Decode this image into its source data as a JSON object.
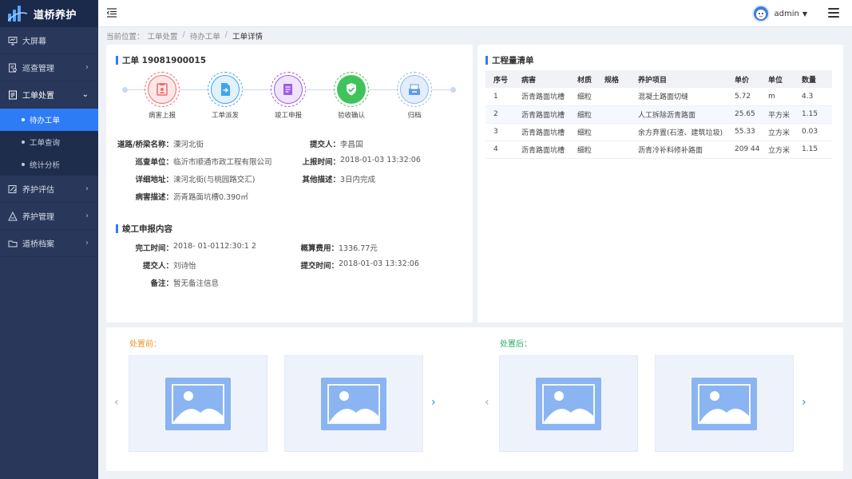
{
  "app": {
    "title": "道桥养护"
  },
  "sidebar": {
    "items": [
      {
        "label": "大屏幕",
        "icon": "monitor-icon"
      },
      {
        "label": "巡查管理",
        "icon": "inspection-icon"
      },
      {
        "label": "工单处置",
        "icon": "workorder-icon",
        "open": true,
        "children": [
          {
            "label": "待办工单",
            "active": true
          },
          {
            "label": "工单查询"
          },
          {
            "label": "统计分析"
          }
        ]
      },
      {
        "label": "养护评估",
        "icon": "evaluate-icon"
      },
      {
        "label": "养护管理",
        "icon": "maintenance-icon"
      },
      {
        "label": "道桥档案",
        "icon": "archive-icon"
      }
    ]
  },
  "header": {
    "user": "admin"
  },
  "breadcrumb": {
    "prefix": "当前位置：",
    "items": [
      "工单处置",
      "待办工单"
    ],
    "separator": "/",
    "current": "工单详情"
  },
  "order": {
    "title": "工单 19081900015",
    "steps": [
      {
        "label": "病害上报",
        "color": "#f06a6a",
        "icon": "report-icon"
      },
      {
        "label": "工单派发",
        "color": "#3fa4f2",
        "icon": "dispatch-icon"
      },
      {
        "label": "竣工申报",
        "color": "#9b5de5",
        "icon": "complete-icon"
      },
      {
        "label": "验收确认",
        "color": "#3fc35b",
        "icon": "shield-check-icon"
      },
      {
        "label": "归档",
        "color": "#5b9bf0",
        "icon": "archive-box-icon"
      }
    ],
    "fields": {
      "road": {
        "k": "道路/桥梁名称：",
        "v": "溧河北街"
      },
      "submitter": {
        "k": "提交人：",
        "v": "李昌国"
      },
      "unit": {
        "k": "巡查单位：",
        "v": "临沂市顺通市政工程有限公司"
      },
      "report_time": {
        "k": "上报时间：",
        "v": "2018-01-03 13:32:06"
      },
      "address": {
        "k": "详细地址：",
        "v": "涑河北街(与桃园路交汇)"
      },
      "other": {
        "k": "其他描述：",
        "v": "3日内完成"
      },
      "disease": {
        "k": "病害描述：",
        "v": "沥青路面坑槽0.390㎡"
      }
    }
  },
  "completion": {
    "title": "竣工申报内容",
    "fields": {
      "finish_time": {
        "k": "完工时间：",
        "v": "2018- 01-0112:30:1 2"
      },
      "cost": {
        "k": "概算费用：",
        "v": "1336.77元"
      },
      "submitter": {
        "k": "提交人：",
        "v": "刘诗怡"
      },
      "submit_time": {
        "k": "提交时间：",
        "v": "2018-01-03  13:32:06"
      },
      "remark": {
        "k": "备注：",
        "v": "暂无备注信息"
      }
    }
  },
  "quantity": {
    "title": "工程量清单",
    "columns": [
      "序号",
      "病害",
      "材质",
      "规格",
      "养护项目",
      "单价",
      "单位",
      "数量"
    ],
    "rows": [
      [
        "1",
        "沥青路面坑槽",
        "细粒",
        "",
        "混凝土路面切缝",
        "5.72",
        "m",
        "4.3"
      ],
      [
        "2",
        "沥青路面坑槽",
        "细粒",
        "",
        "人工拆除沥青路面",
        "25.65",
        "平方米",
        "1.15"
      ],
      [
        "3",
        "沥青路面坑槽",
        "细粒",
        "",
        "余方弃置(石渣、建筑垃圾)",
        "55.33",
        "立方米",
        "0.03"
      ],
      [
        "4",
        "沥青路面坑槽",
        "细粒",
        "",
        "沥青冷补料修补路面",
        "209 44",
        "立方米",
        "1.15"
      ]
    ]
  },
  "photos": {
    "before_label": "处置前：",
    "after_label": "处置后：",
    "before_color": "#f0932b",
    "after_color": "#27ae60"
  }
}
